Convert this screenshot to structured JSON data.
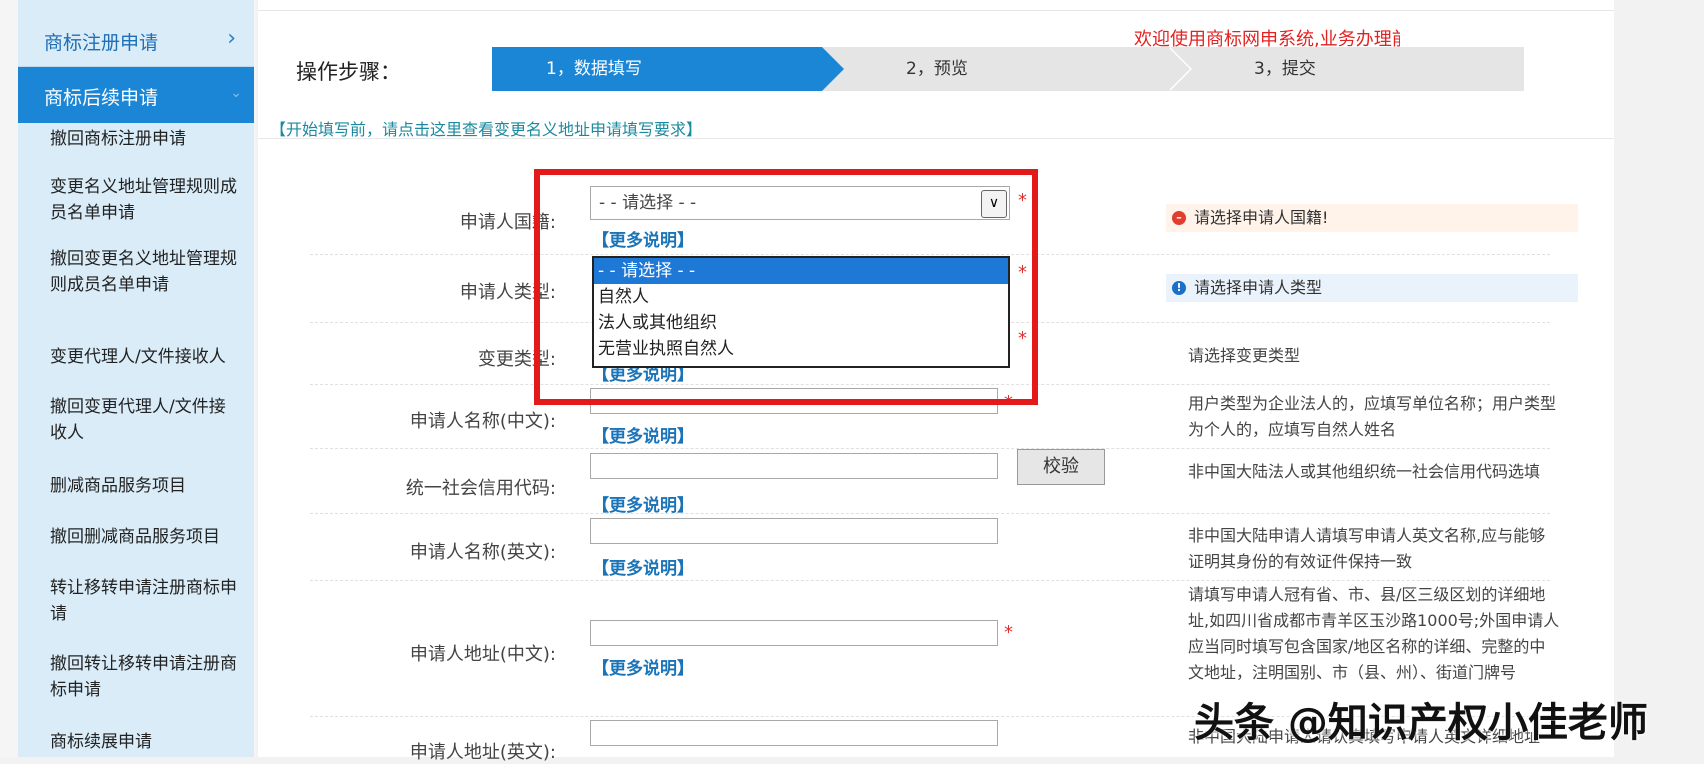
{
  "sidebar": {
    "top_item": "商标注册申请",
    "active_item": "商标后续申请",
    "items": [
      "撤回商标注册申请",
      "变更名义地址管理规则成员名单申请",
      "撤回变更名义地址管理规则成员名单申请",
      "变更代理人/文件接收人",
      "撤回变更代理人/文件接收人",
      "删减商品服务项目",
      "撤回删减商品服务项目",
      "转让移转申请注册商标申请",
      "撤回转让移转申请注册商标申请",
      "商标续展申请"
    ]
  },
  "steps": {
    "label": "操作步骤：",
    "step1": "1，数据填写",
    "step2": "2，预览",
    "step3": "3，提交"
  },
  "notice": "欢迎使用商标网申系统,业务办理前,请详细",
  "hint_link": "【开始填写前，请点击这里查看变更名义地址申请填写要求】",
  "form": {
    "nationality_label": "申请人国籍:",
    "nationality_value": "- - 请选择 - -",
    "type_label": "申请人类型:",
    "change_type_label": "变更类型:",
    "name_cn_label": "申请人名称(中文):",
    "credit_code_label": "统一社会信用代码:",
    "name_en_label": "申请人名称(英文):",
    "address_cn_label": "申请人地址(中文):",
    "address_en_label": "申请人地址(英文):",
    "more": "【更多说明】",
    "required": "*",
    "verify_button": "校验"
  },
  "dropdown": {
    "options": [
      "- - 请选择 - -",
      "自然人",
      "法人或其他组织",
      "无营业执照自然人"
    ]
  },
  "messages": {
    "nationality_error": "请选择申请人国籍!",
    "type_info": "请选择申请人类型"
  },
  "help": {
    "change_type": "请选择变更类型",
    "name_cn": "用户类型为企业法人的，应填写单位名称；用户类型为个人的，应填写自然人姓名",
    "credit_code": "非中国大陆法人或其他组织统一社会信用代码选填",
    "name_en": "非中国大陆申请人请填写申请人英文名称,应与能够证明其身份的有效证件保持一致",
    "address_cn": "请填写申请人冠有省、市、县/区三级区划的详细地址,如四川省成都市青羊区玉沙路1000号;外国申请人应当同时填写包含国家/地区名称的详细、完整的中文地址，注明国别、市（县、州）、街道门牌号",
    "address_en": "非中国大陆申请人请认真填写申请人英文详细地址"
  },
  "watermark": "头条 @知识产权小佳老师",
  "colors": {
    "primary": "#1b86d6",
    "error": "#e03e2e",
    "redbox": "#e21a1a"
  }
}
